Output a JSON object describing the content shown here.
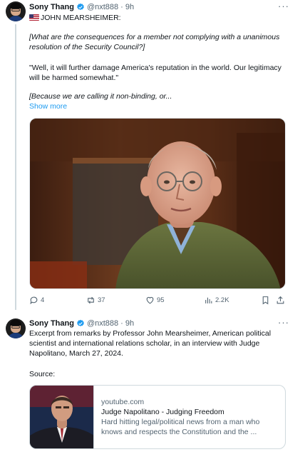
{
  "tweet1": {
    "author_name": "Sony Thang",
    "handle": "@nxt888",
    "separator": "·",
    "time": "9h",
    "more_label": "···",
    "heading": "JOHN MEARSHEIMER:",
    "question1": "[What are the consequences for a member not complying with a unanimous resolution of the Security Council?]",
    "quote1": "\"Well, it will further damage America's reputation in the world. Our legitimacy will be harmed somewhat.\"",
    "truncated": "[Because we are calling it non-binding, or...",
    "show_more": "Show more",
    "actions": {
      "replies": "4",
      "reposts": "37",
      "likes": "95",
      "views": "2.2K"
    }
  },
  "tweet2": {
    "author_name": "Sony Thang",
    "handle": "@nxt888",
    "separator": "·",
    "time": "9h",
    "more_label": "···",
    "body": "Excerpt from remarks by Professor John Mearsheimer, American political scientist and international relations scholar, in an interview with Judge Napolitano, March 27, 2024.",
    "source_label": "Source:",
    "card": {
      "domain": "youtube.com",
      "title": "Judge Napolitano - Judging Freedom",
      "description": "Hard hitting legal/political news from a man who knows and respects the Constitution and the ..."
    }
  },
  "colors": {
    "accent": "#1d9bf0",
    "secondary_text": "#536471",
    "thread_line": "#cfd9de"
  },
  "icons": [
    "verified-badge-icon",
    "us-flag-icon",
    "reply-icon",
    "repost-icon",
    "like-icon",
    "views-icon",
    "bookmark-icon",
    "share-icon",
    "more-icon"
  ]
}
